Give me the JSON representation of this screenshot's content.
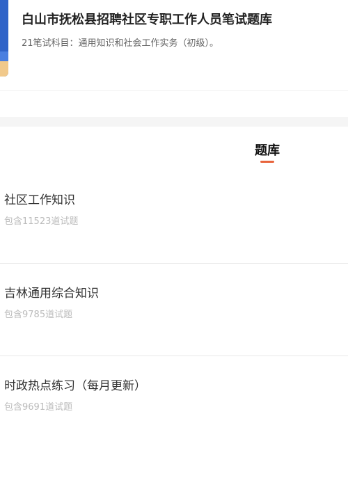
{
  "header": {
    "title": "白山市抚松县招聘社区专职工作人员笔试题库",
    "subtitle": "21笔试科目：通用知识和社会工作实务（初级）。",
    "cover_color": "#2f63c8"
  },
  "tabs": [
    {
      "label": "题库",
      "active": true,
      "accent_color": "#e8643c"
    }
  ],
  "question_banks": [
    {
      "name": "社区工作知识",
      "count_text": "包含11523道试题"
    },
    {
      "name": "吉林通用综合知识",
      "count_text": "包含9785道试题"
    },
    {
      "name": "时政热点练习（每月更新）",
      "count_text": "包含9691道试题"
    }
  ]
}
